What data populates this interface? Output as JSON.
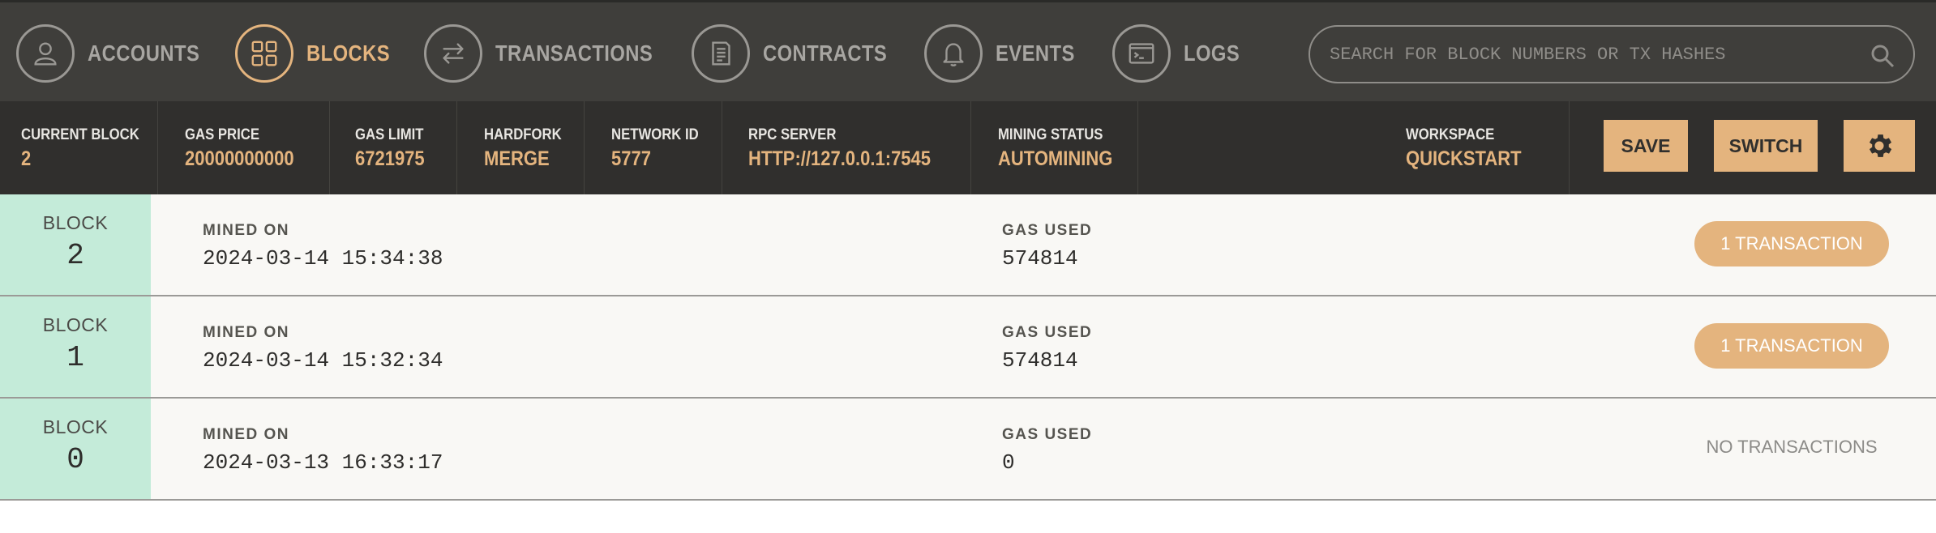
{
  "nav": {
    "items": [
      {
        "label": "ACCOUNTS",
        "icon": "account-icon"
      },
      {
        "label": "BLOCKS",
        "icon": "blocks-icon"
      },
      {
        "label": "TRANSACTIONS",
        "icon": "transactions-icon"
      },
      {
        "label": "CONTRACTS",
        "icon": "contracts-icon"
      },
      {
        "label": "EVENTS",
        "icon": "bell-icon"
      },
      {
        "label": "LOGS",
        "icon": "logs-icon"
      }
    ],
    "active": "BLOCKS"
  },
  "search": {
    "placeholder": "SEARCH FOR BLOCK NUMBERS OR TX HASHES"
  },
  "status": {
    "current_block_label": "CURRENT BLOCK",
    "current_block": "2",
    "gas_price_label": "GAS PRICE",
    "gas_price": "20000000000",
    "gas_limit_label": "GAS LIMIT",
    "gas_limit": "6721975",
    "hardfork_label": "HARDFORK",
    "hardfork": "MERGE",
    "network_id_label": "NETWORK ID",
    "network_id": "5777",
    "rpc_server_label": "RPC SERVER",
    "rpc_server": "HTTP://127.0.0.1:7545",
    "mining_status_label": "MINING STATUS",
    "mining_status": "AUTOMINING",
    "workspace_label": "WORKSPACE",
    "workspace": "QUICKSTART",
    "save_label": "SAVE",
    "switch_label": "SWITCH"
  },
  "blocks": [
    {
      "block_label": "BLOCK",
      "number": "2",
      "mined_on_label": "MINED ON",
      "mined_on": "2024-03-14 15:34:38",
      "gas_used_label": "GAS USED",
      "gas_used": "574814",
      "tx_label": "1 TRANSACTION"
    },
    {
      "block_label": "BLOCK",
      "number": "1",
      "mined_on_label": "MINED ON",
      "mined_on": "2024-03-14 15:32:34",
      "gas_used_label": "GAS USED",
      "gas_used": "574814",
      "tx_label": "1 TRANSACTION"
    },
    {
      "block_label": "BLOCK",
      "number": "0",
      "mined_on_label": "MINED ON",
      "mined_on": "2024-03-13 16:33:17",
      "gas_used_label": "GAS USED",
      "gas_used": "0",
      "tx_label": "NO TRANSACTIONS"
    }
  ],
  "colors": {
    "accent": "#e4b47e",
    "nav_bg": "#3f3e3b",
    "status_bg": "#302f2d",
    "block_num_bg": "#c4ebd9"
  }
}
